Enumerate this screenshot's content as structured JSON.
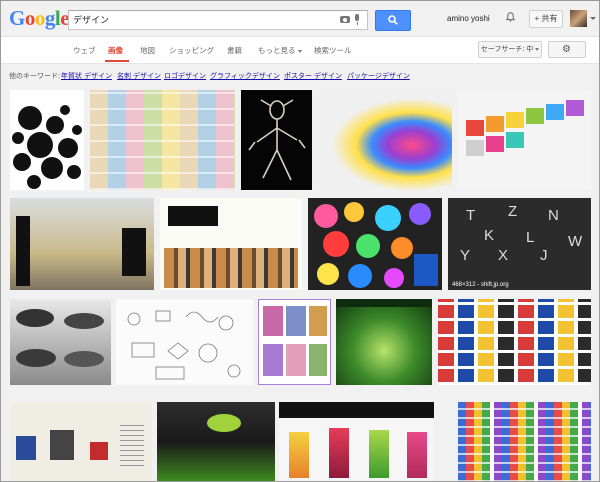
{
  "header": {
    "logo": "Google",
    "query": "デザイン",
    "user_name": "amino yoshi",
    "share_label": "+ 共有"
  },
  "nav": {
    "items": [
      "ウェブ",
      "画像",
      "地図",
      "ショッピング",
      "書籍",
      "もっと見る",
      "検索ツール"
    ],
    "active": "画像",
    "safesearch": "セーフサーチ: 中"
  },
  "related": {
    "label": "他のキーワード:",
    "items": [
      "年賀状 デザイン",
      "名刺 デザイン",
      "ロゴデザイン",
      "グラフィックデザイン",
      "ポスター デザイン",
      "パッケージデザイン"
    ]
  },
  "results": {
    "caption_c": "468×312 - shift.jp.org"
  },
  "colors": {
    "accent_red": "#dd4b39",
    "search_blue": "#4d90fe",
    "link_blue": "#1a0dab"
  },
  "icons": [
    "camera-icon",
    "microphone-icon",
    "search-icon",
    "bell-icon",
    "gear-icon",
    "chevron-down-icon"
  ]
}
